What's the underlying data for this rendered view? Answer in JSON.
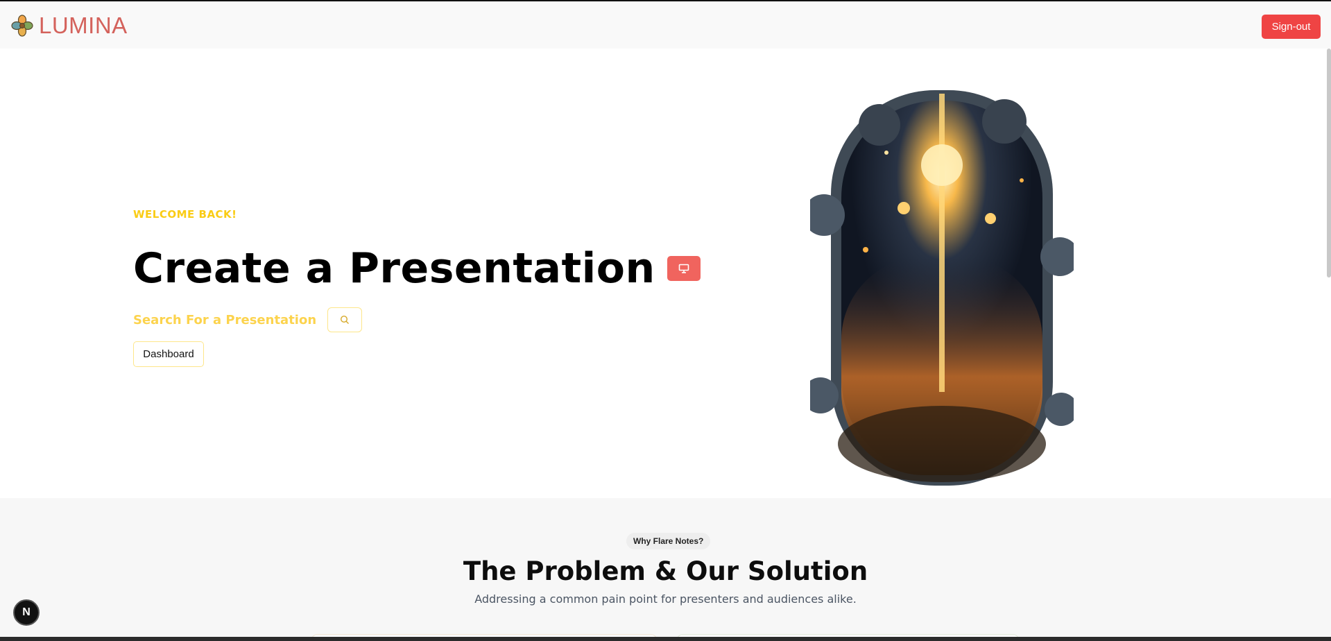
{
  "header": {
    "brand_name": "LUMINA",
    "signout_label": "Sign-out"
  },
  "hero": {
    "welcome": "WELCOME BACK!",
    "title": "Create a Presentation",
    "search_label": "Search For a Presentation",
    "dashboard_label": "Dashboard",
    "present_icon": "presentation-icon",
    "search_icon": "search-icon"
  },
  "section": {
    "pill": "Why Flare Notes?",
    "heading": "The Problem & Our Solution",
    "subheading": "Addressing a common pain point for presenters and audiences alike."
  },
  "dev_badge": {
    "letter": "N"
  },
  "colors": {
    "brand": "#d4625c",
    "accent_yellow": "#facc15",
    "danger": "#ef4444",
    "coral": "#f0645e"
  }
}
